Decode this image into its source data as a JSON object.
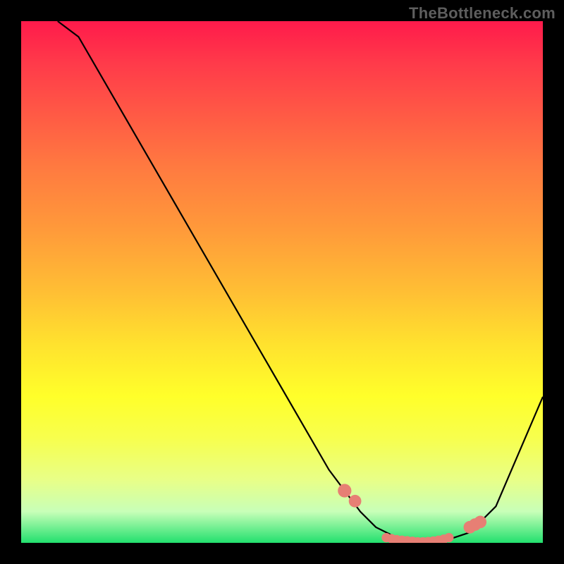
{
  "watermark": "TheBottleneck.com",
  "chart_data": {
    "type": "line",
    "title": "",
    "xlabel": "",
    "ylabel": "",
    "xlim": [
      0,
      100
    ],
    "ylim": [
      0,
      100
    ],
    "series": [
      {
        "name": "curve",
        "x": [
          7,
          11,
          59,
          62,
          65,
          68,
          72,
          76,
          80,
          83,
          86,
          88,
          91,
          100
        ],
        "y": [
          100,
          97,
          14,
          10,
          6,
          3,
          1,
          0,
          0,
          1,
          2,
          4,
          7,
          28
        ]
      }
    ],
    "markers": {
      "name": "highlighted-points",
      "color": "#e77f74",
      "x": [
        62,
        64,
        70,
        71,
        72,
        73,
        74,
        75,
        76,
        77,
        78,
        79,
        80,
        81,
        82,
        86,
        87,
        88
      ],
      "y": [
        10,
        8,
        1,
        0.8,
        0.6,
        0.5,
        0.4,
        0.3,
        0.2,
        0.2,
        0.25,
        0.35,
        0.5,
        0.7,
        1.0,
        3,
        3.5,
        4
      ],
      "radius": [
        1.3,
        1.2,
        0.9,
        0.9,
        0.9,
        0.9,
        0.9,
        0.9,
        0.9,
        0.9,
        0.9,
        0.9,
        0.9,
        0.9,
        0.9,
        1.2,
        1.2,
        1.2
      ]
    }
  }
}
